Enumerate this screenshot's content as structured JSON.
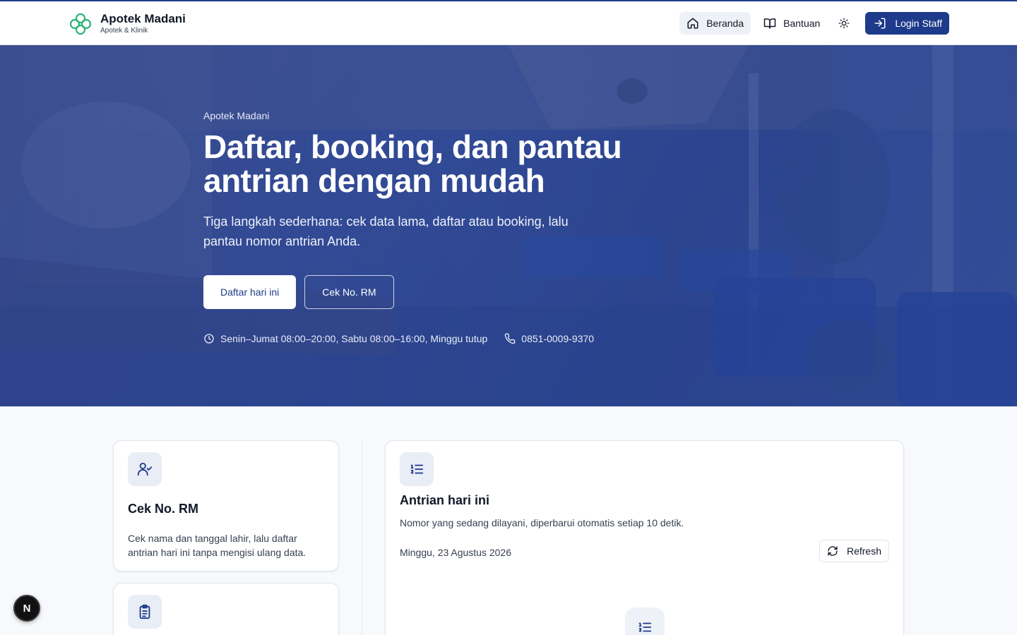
{
  "brand": {
    "name": "Apotek Madani",
    "subtitle": "Apotek & Klinik"
  },
  "nav": {
    "items": [
      {
        "label": "Beranda",
        "icon": "home-icon",
        "active": true
      },
      {
        "label": "Bantuan",
        "icon": "book-icon",
        "active": false
      }
    ],
    "theme_icon": "sun-icon",
    "login_label": "Login Staff"
  },
  "hero": {
    "eyebrow": "Apotek Madani",
    "title_line1": "Daftar, booking, dan pantau",
    "title_line2": "antrian dengan mudah",
    "description": "Tiga langkah sederhana: cek data lama, daftar atau booking, lalu pantau nomor antrian Anda.",
    "primary_cta": "Daftar hari ini",
    "secondary_cta": "Cek No. RM",
    "hours": "Senin–Jumat 08:00–20:00, Sabtu 08:00–16:00, Minggu tutup",
    "phone": "0851-0009-9370"
  },
  "cards": {
    "cek_rm": {
      "title": "Cek No. RM",
      "description": "Cek nama dan tanggal lahir, lalu daftar antrian hari ini tanpa mengisi ulang data."
    },
    "antrian": {
      "title": "Antrian hari ini",
      "description": "Nomor yang sedang dilayani, diperbarui otomatis setiap 10 detik.",
      "date": "Minggu, 23 Agustus 2026",
      "refresh_label": "Refresh"
    }
  },
  "dev_badge": "N",
  "colors": {
    "primary": "#1e3a8a",
    "accent_green": "#2bb673",
    "card_icon_bg": "#e9edf6"
  }
}
